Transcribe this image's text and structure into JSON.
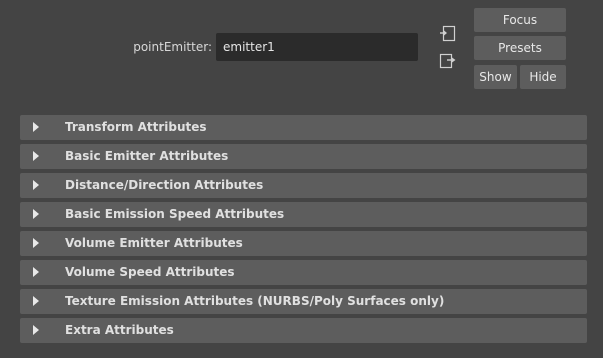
{
  "header": {
    "node_type_label": "pointEmitter:",
    "node_name": "emitter1",
    "buttons": {
      "focus": "Focus",
      "presets": "Presets",
      "show": "Show",
      "hide": "Hide"
    },
    "icons": [
      "load-attributes-icon",
      "copy-tab-icon"
    ]
  },
  "sections": [
    {
      "label": "Transform Attributes"
    },
    {
      "label": "Basic Emitter Attributes"
    },
    {
      "label": "Distance/Direction Attributes"
    },
    {
      "label": "Basic Emission Speed Attributes"
    },
    {
      "label": "Volume Emitter Attributes"
    },
    {
      "label": "Volume Speed Attributes"
    },
    {
      "label": "Texture Emission Attributes (NURBS/Poly Surfaces only)"
    },
    {
      "label": "Extra Attributes"
    }
  ],
  "colors": {
    "background": "#444444",
    "frame": "#5d5d5d",
    "field": "#2b2b2b",
    "text": "#e0e0e0"
  }
}
